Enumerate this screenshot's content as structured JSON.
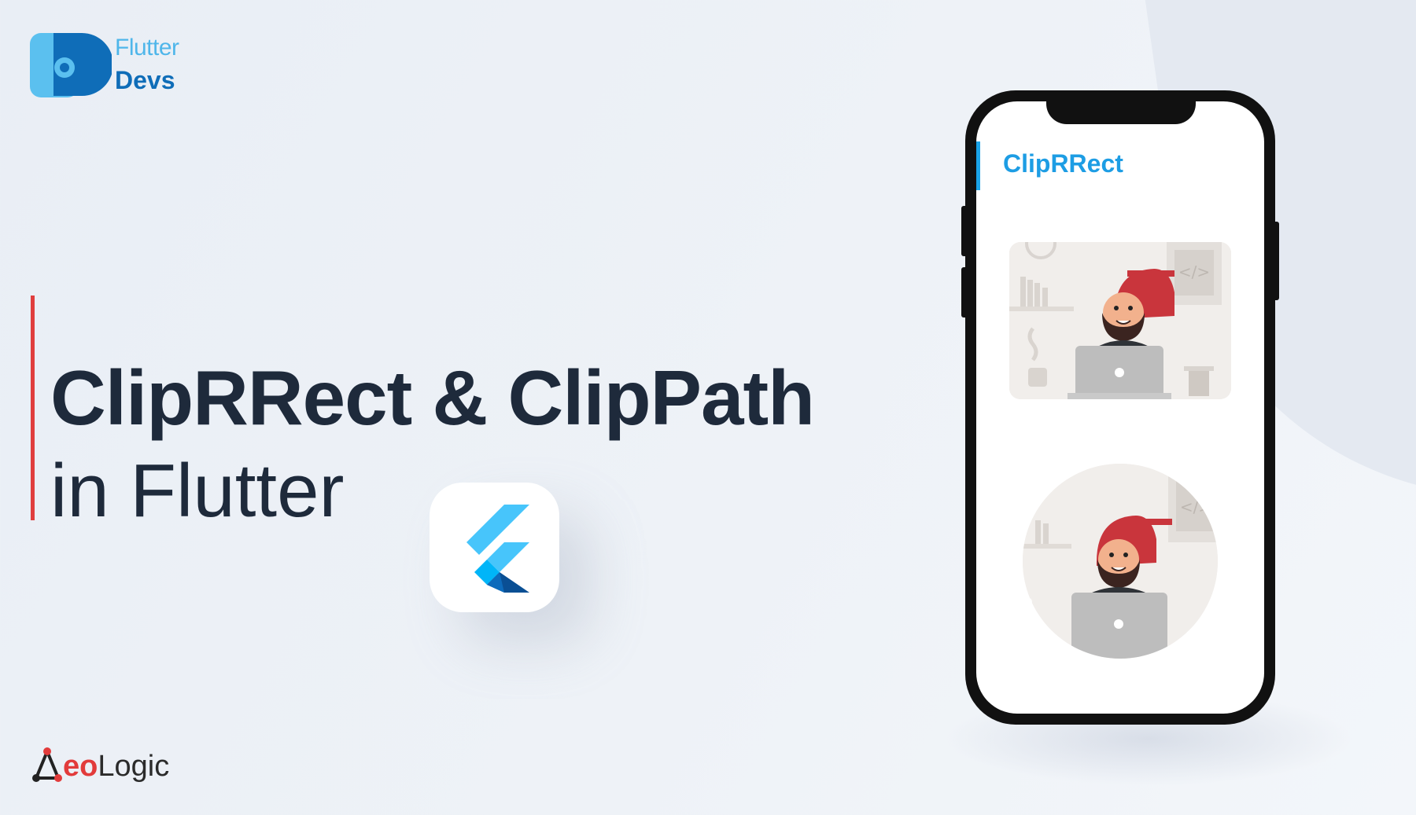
{
  "brand": {
    "top_line": "Flutter",
    "bottom_line": "Devs",
    "primary_color": "#0f6db8",
    "secondary_color": "#4fb6ea"
  },
  "headline": {
    "line1": "ClipRRect & ClipPath",
    "line2": "in Flutter",
    "accent_color": "#e03e3e",
    "text_color": "#1e2a3b"
  },
  "flutter_logo": {
    "icon": "flutter-logo-icon"
  },
  "footer_brand": {
    "part1": "eo",
    "part2": "Logic",
    "accent_color": "#e23b3b"
  },
  "phone": {
    "app_title": "ClipRRect",
    "app_title_color": "#1d9de4",
    "images": [
      {
        "name": "developer-illustration-rounded",
        "icon": "developer-at-laptop-icon"
      },
      {
        "name": "developer-illustration-circle",
        "icon": "developer-at-laptop-icon"
      }
    ]
  }
}
